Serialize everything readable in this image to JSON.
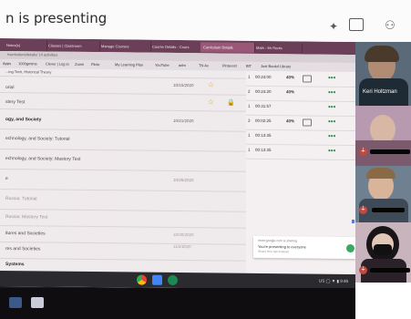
{
  "meet": {
    "presenting_text": "n is presenting",
    "icons": [
      "sparkle-icon",
      "chat-icon",
      "people-icon"
    ]
  },
  "browser": {
    "tabs": [
      {
        "label": "Notes(s)"
      },
      {
        "label": "Classes | Classroom"
      },
      {
        "label": "Manage Courses"
      },
      {
        "label": "Course Details - Cours"
      },
      {
        "label": "Curriculum Details"
      },
      {
        "label": "Math - Mr Roots"
      }
    ],
    "url": "/curriculum/details/ 14 activities",
    "bookmarks": [
      "Apps",
      "1000gmims",
      "Clever | Log in",
      "Zoom",
      "Flickr",
      "My Learning Plan",
      "YouTube",
      "adm",
      "TN Ax",
      "Pinterest",
      "BlT",
      "Just Bookd Library"
    ]
  },
  "content": {
    "header": "...ing Tech, Historical Theory",
    "rows": [
      {
        "label": "orial",
        "date": "10/15/2020",
        "star": true,
        "lock": false,
        "style": "normal"
      },
      {
        "label": "stery Test",
        "date": "",
        "star": true,
        "lock": true,
        "style": "normal"
      },
      {
        "label": "ogy, and Society",
        "date": "10/21/2020",
        "star": false,
        "lock": false,
        "style": "bold"
      },
      {
        "label": "echnology, and Society: Tutorial",
        "date": "",
        "star": false,
        "lock": false,
        "style": "normal"
      },
      {
        "label": "echnology, and Society: Mastery Test",
        "date": "",
        "star": false,
        "lock": false,
        "style": "normal"
      },
      {
        "label": "e",
        "date": "10/26/2020",
        "star": false,
        "lock": false,
        "style": "normal"
      },
      {
        "label": "Russia: Tutorial",
        "date": "",
        "star": false,
        "lock": false,
        "style": "faded"
      },
      {
        "label": "Russia: Mastery Test",
        "date": "",
        "star": false,
        "lock": false,
        "style": "faded"
      },
      {
        "label": "itures and Societies",
        "date": "10/30/2020",
        "star": false,
        "lock": false,
        "style": "normal"
      },
      {
        "label": "res and Societies",
        "date": "11/2/2020",
        "star": false,
        "lock": false,
        "style": "normal"
      },
      {
        "label": "Systems",
        "date": "",
        "star": false,
        "lock": false,
        "style": "bold"
      }
    ]
  },
  "progress_panel": {
    "rows": [
      {
        "num": "1",
        "time": "00:24:00",
        "pct": "40%"
      },
      {
        "num": "2",
        "time": "00:24:20",
        "pct": "40%"
      },
      {
        "num": "1",
        "time": "00:31:57",
        "pct": ""
      },
      {
        "num": "3",
        "time": "00:02:25",
        "pct": "40%"
      },
      {
        "num": "1",
        "time": "00:13:35",
        "pct": ""
      },
      {
        "num": "1",
        "time": "00:13:35",
        "pct": ""
      }
    ]
  },
  "notification": {
    "title": "meet.google.com is sharing",
    "text": "You're presenting to everyone",
    "sub": "Share this tab instead"
  },
  "taskbar": {
    "tray": "US ◯ ▼ ▮ 9:46"
  },
  "participants": [
    {
      "name": "Keri Holtzman"
    },
    {
      "name": ""
    },
    {
      "name": ""
    },
    {
      "name": ""
    }
  ],
  "colors": {
    "tab_bar": "#6b3f57",
    "meet_bg": "#fbfbfb",
    "green_dots": "#2c8a4a",
    "star": "#d9a93a"
  }
}
